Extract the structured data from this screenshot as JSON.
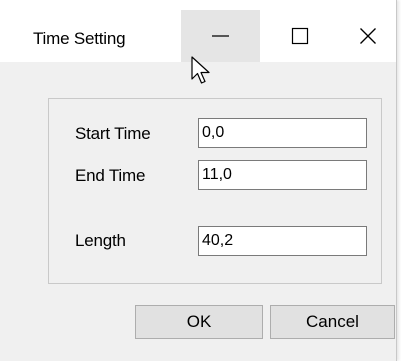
{
  "window": {
    "title": "Time Setting"
  },
  "fields": {
    "start_time": {
      "label": "Start Time",
      "value": "0,0"
    },
    "end_time": {
      "label": "End Time",
      "value": "11,0"
    },
    "length": {
      "label": "Length",
      "value": "40,2"
    }
  },
  "buttons": {
    "ok_label": "OK",
    "cancel_label": "Cancel"
  },
  "icons": {
    "minimize": "minimize-icon",
    "maximize": "maximize-icon",
    "close": "close-icon",
    "cursor": "mouse-pointer-icon"
  },
  "colors": {
    "dialog_background": "#f0f0f0",
    "titlebar_background": "#ffffff",
    "minimize_hover": "#e5e5e5",
    "input_border": "#7a7a7a",
    "button_face": "#e1e1e1"
  }
}
